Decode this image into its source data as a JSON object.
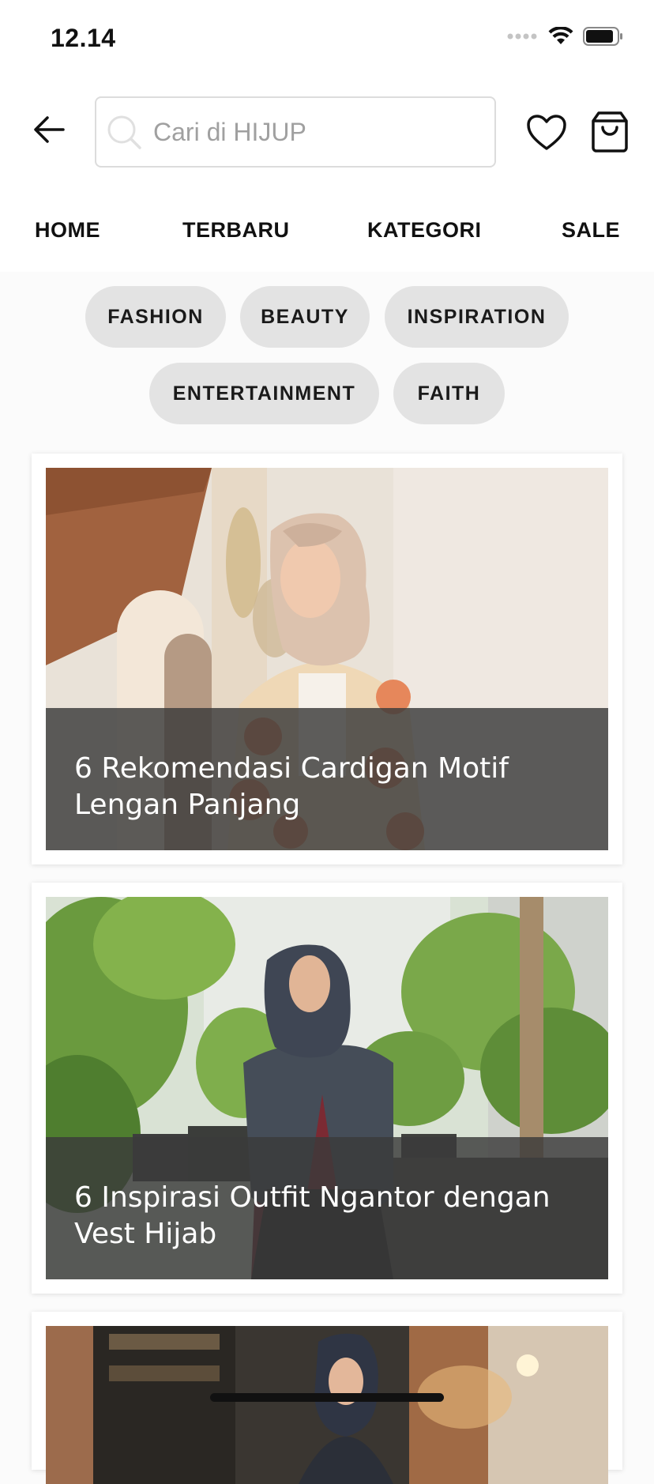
{
  "status_bar": {
    "time": "12.14",
    "icons": [
      "signal-dots-icon",
      "wifi-icon",
      "battery-icon"
    ]
  },
  "header": {
    "back_icon": "arrow-left-icon",
    "search": {
      "placeholder": "Cari di HIJUP",
      "value": ""
    },
    "wishlist_icon": "heart-icon",
    "cart_icon": "shopping-bag-icon"
  },
  "nav": {
    "items": [
      {
        "label": "HOME"
      },
      {
        "label": "TERBARU"
      },
      {
        "label": "KATEGORI"
      },
      {
        "label": "SALE"
      }
    ]
  },
  "categories": [
    {
      "label": "FASHION"
    },
    {
      "label": "BEAUTY"
    },
    {
      "label": "INSPIRATION"
    },
    {
      "label": "ENTERTAINMENT"
    },
    {
      "label": "FAITH"
    }
  ],
  "articles": [
    {
      "title": "6 Rekomendasi Cardigan Motif Lengan Panjang"
    },
    {
      "title": "6 Inspirasi Outfit Ngantor dengan Vest Hijab"
    },
    {
      "title": ""
    }
  ],
  "colors": {
    "background": "#fbfbfb",
    "chip": "#e3e3e3",
    "overlay": "#3a3a3a",
    "text": "#111111"
  }
}
